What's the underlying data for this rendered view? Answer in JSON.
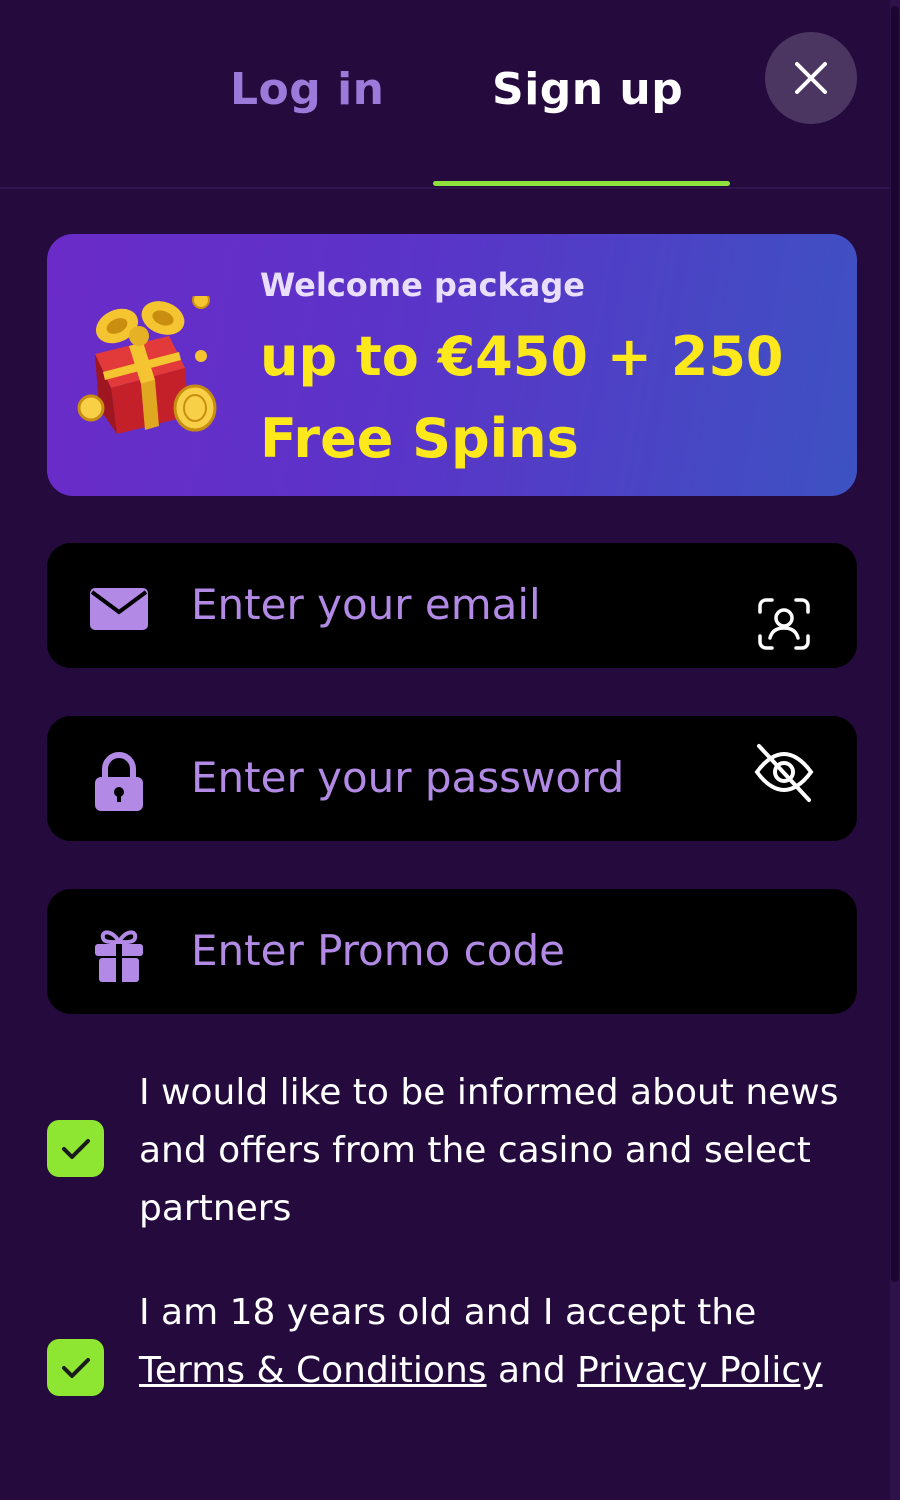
{
  "tabs": {
    "login_label": "Log in",
    "signup_label": "Sign up",
    "active": "Sign up"
  },
  "close_icon": "close-icon",
  "banner": {
    "subtitle": "Welcome package",
    "title": "up to €450 + 250 Free Spins",
    "image": "gift-box-with-coins"
  },
  "form": {
    "email": {
      "placeholder": "Enter your email",
      "value": "",
      "icon": "envelope-icon",
      "action_icon": "face-scan-icon"
    },
    "password": {
      "placeholder": "Enter your password",
      "value": "",
      "icon": "lock-icon",
      "action_icon": "eye-off-icon"
    },
    "promo": {
      "placeholder": "Enter Promo code",
      "value": "",
      "icon": "gift-icon"
    }
  },
  "consents": {
    "news": {
      "checked": true,
      "text": "I would like to be informed about news and offers from the casino and select partners"
    },
    "terms": {
      "checked": true,
      "prefix": "I am 18 years old and I accept the",
      "terms_link": "Terms & Conditions",
      "and": "and",
      "privacy_link": "Privacy Policy"
    }
  },
  "colors": {
    "background": "#240a3d",
    "accent_green": "#8fe13b",
    "banner_text": "#fde81c",
    "placeholder": "#b28ae6",
    "inactive_tab": "#9b7ad9"
  }
}
